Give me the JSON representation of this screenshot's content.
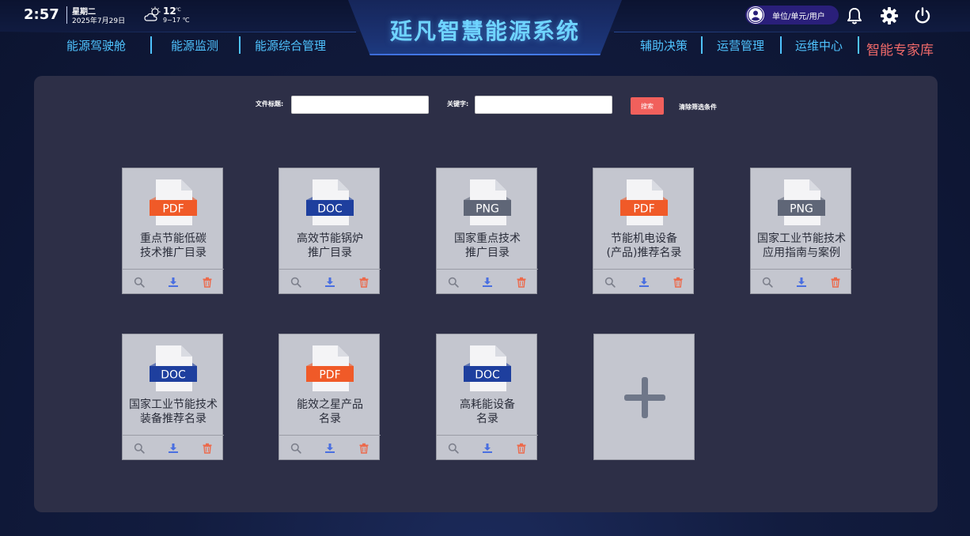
{
  "header": {
    "time": "2:57",
    "weekday": "星期二",
    "date": "2025年7月29日",
    "weather": {
      "icon": "partly-cloudy-icon",
      "temp": "12",
      "unit": "℃",
      "range": "9~17 ℃"
    },
    "title": "延凡智慧能源系统",
    "user_label": "单位/单元/用户",
    "icons": [
      "user-avatar-icon",
      "bell-icon",
      "gear-icon",
      "power-icon"
    ]
  },
  "nav": {
    "left": [
      "能源驾驶舱",
      "能源监测",
      "能源综合管理"
    ],
    "right": [
      "辅助决策",
      "运营管理",
      "运维中心",
      "智能专家库"
    ],
    "active": "智能专家库"
  },
  "filters": {
    "title_label": "文件标题:",
    "title_value": "",
    "keyword_label": "关键字:",
    "keyword_value": "",
    "search_label": "搜索",
    "clear_label": "清除筛选条件"
  },
  "files": [
    {
      "type": "PDF",
      "title1": "重点节能低碳",
      "title2": "技术推广目录"
    },
    {
      "type": "DOC",
      "title1": "高效节能锅炉",
      "title2": "推广目录"
    },
    {
      "type": "PNG",
      "title1": "国家重点技术",
      "title2": "推广目录"
    },
    {
      "type": "PDF",
      "title1": "节能机电设备",
      "title2": "(产品)推荐名录"
    },
    {
      "type": "PNG",
      "title1": "国家工业节能技术",
      "title2": "应用指南与案例"
    },
    {
      "type": "DOC",
      "title1": "国家工业节能技术",
      "title2": "装备推荐名录"
    },
    {
      "type": "PDF",
      "title1": "能效之星产品",
      "title2": "名录"
    },
    {
      "type": "DOC",
      "title1": "高耗能设备",
      "title2": "名录"
    }
  ],
  "colors": {
    "PDF": "#f05a28",
    "DOC": "#1e3f9e",
    "PNG": "#5f6677",
    "accent": "#4fc3ff",
    "active_nav": "#f16a6a",
    "search_button": "#f1605c"
  }
}
